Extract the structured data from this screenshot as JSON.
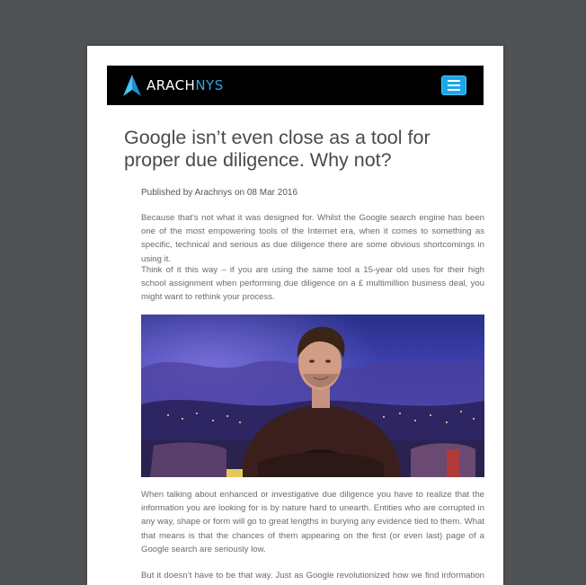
{
  "header": {
    "logo_prefix": "ARACH",
    "logo_suffix": "NYS",
    "logo_icon": "arachnys-a-logo-icon",
    "menu_icon": "hamburger-menu-icon",
    "accent_color": "#1aa6e8"
  },
  "article": {
    "title": "Google isn’t even close as a tool for proper due diligence. Why not?",
    "meta": "Published by Arachnys on 08 Mar 2016",
    "paragraphs": [
      "Because that’s not what it was designed for. Whilst the Google search engine has been one of the most empowering tools of the Internet era, when it comes to something as specific, technical and serious as due diligence there are some obvious shortcomings in using it.",
      "Think of it this way – if you are using the same tool a 15-year old uses for their high school assignment when performing due diligence on a £ multimillion business deal, you might want to rethink your process.",
      "When talking about enhanced or investigative due diligence you have to realize that the information you are looking for is by nature hard to unearth. Entities who are corrupted in any way, shape or form will go to great lengths in burying any evidence tied to them. What that means is that the chances of them appearing on the first (or even last) page of a Google search are seriously low.",
      "But it doesn’t have to be that way. Just as Google revolutionized how we find information on the web, purpose-built tools can transform due diligence."
    ]
  }
}
